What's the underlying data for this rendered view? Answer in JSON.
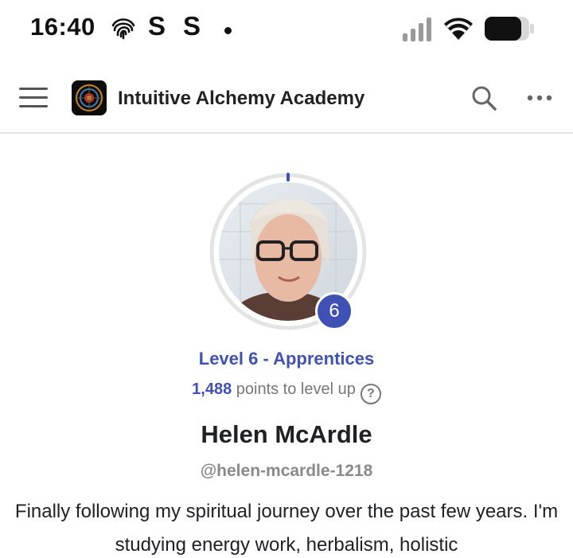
{
  "status_bar": {
    "time": "16:40",
    "s1": "S",
    "s2": "S",
    "icons": [
      "fingerprint-icon",
      "signal-icon",
      "wifi-icon",
      "battery-icon"
    ]
  },
  "app_bar": {
    "title": "Intuitive Alchemy Academy",
    "icons": [
      "menu-icon",
      "app-logo",
      "search-icon",
      "more-icon"
    ]
  },
  "profile": {
    "level_number": "6",
    "level_label": "Level 6 - Apprentices",
    "points": "1,488",
    "points_suffix": " points to level up",
    "help_symbol": "?",
    "name": "Helen McArdle",
    "handle": "@helen-mcardle-1218",
    "bio": "Finally following my spiritual journey over the past few years. I'm studying energy work, herbalism, holistic"
  },
  "colors": {
    "accent": "#3f51b5",
    "muted_text": "#777777",
    "divider": "#e3e3e3"
  }
}
